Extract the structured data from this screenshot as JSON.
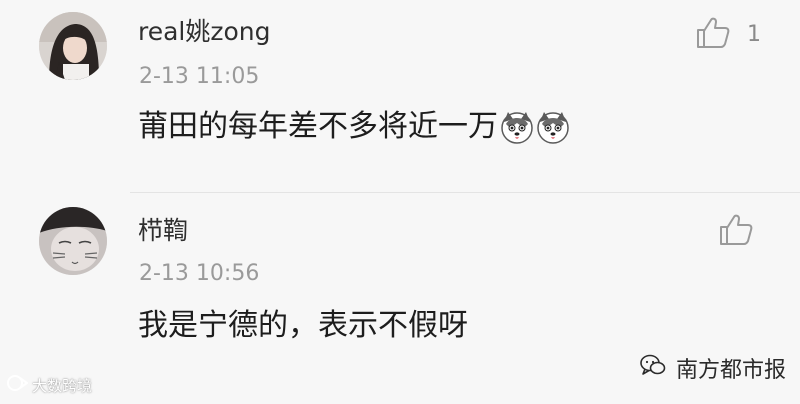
{
  "comments": [
    {
      "username": "real姚zong",
      "timestamp": "2-13 11:05",
      "text": "莆田的每年差不多将近一万",
      "emojis": [
        "husky-emoji",
        "husky-emoji"
      ],
      "likes": "1",
      "avatar": "user-avatar-girl"
    },
    {
      "username": "栉鞫",
      "timestamp": "2-13 10:56",
      "text": "我是宁德的，表示不假呀",
      "emojis": [],
      "likes": "",
      "avatar": "user-avatar-cat-face"
    }
  ],
  "watermarks": {
    "left": "大数跨境",
    "right": "南方都市报"
  },
  "colors": {
    "background": "#f7f7f7",
    "username": "#2f2f2f",
    "timestamp": "#9a9a9a",
    "content": "#1d1d1d",
    "like_icon": "#9a9a9a"
  }
}
